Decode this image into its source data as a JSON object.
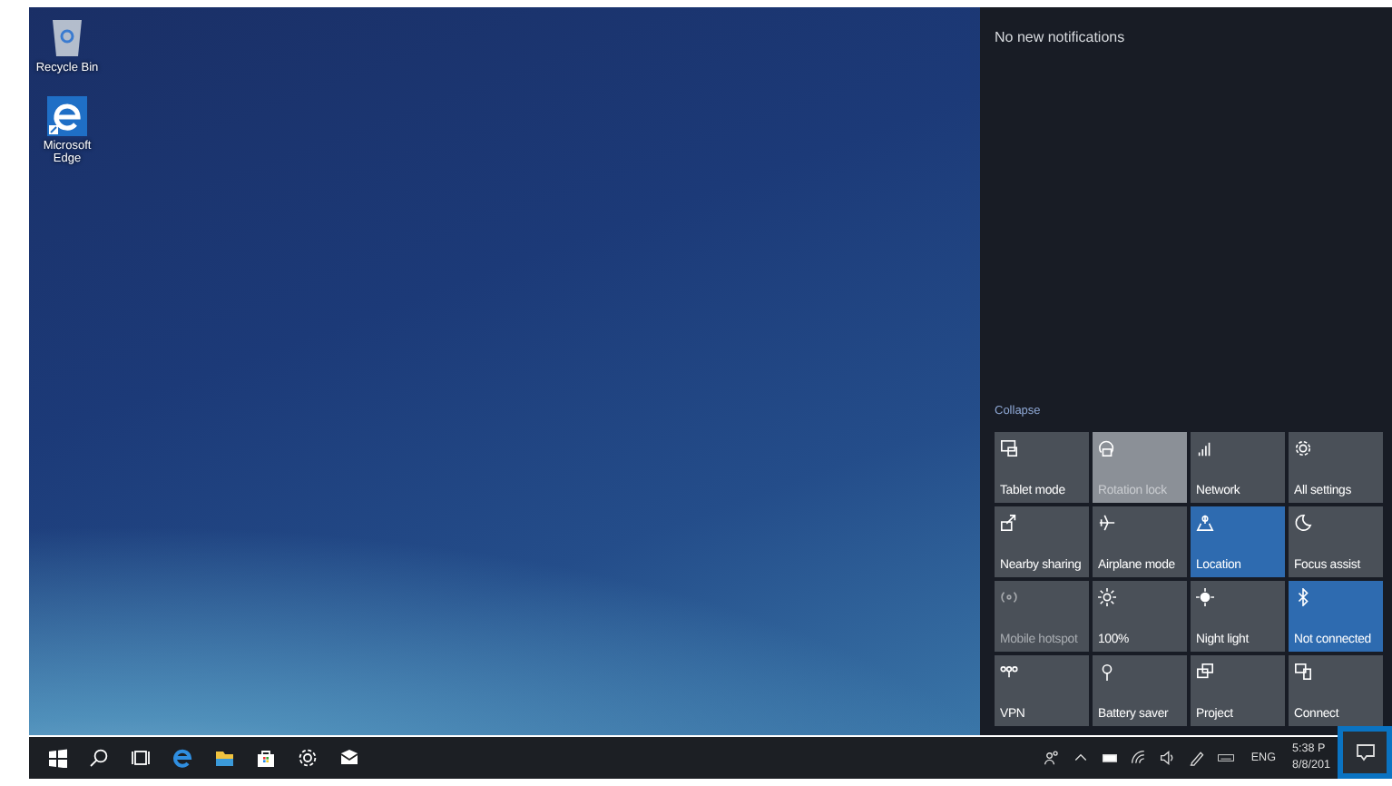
{
  "desktop": {
    "icons": [
      {
        "label": "Recycle Bin"
      },
      {
        "label": "Microsoft Edge"
      }
    ]
  },
  "action_center": {
    "message": "No new notifications",
    "collapse": "Collapse",
    "tiles": [
      {
        "label": "Tablet mode",
        "on": false,
        "disabled": false
      },
      {
        "label": "Rotation lock",
        "on": false,
        "disabled": true
      },
      {
        "label": "Network",
        "on": false,
        "disabled": false
      },
      {
        "label": "All settings",
        "on": false,
        "disabled": false
      },
      {
        "label": "Nearby sharing",
        "on": false,
        "disabled": false
      },
      {
        "label": "Airplane mode",
        "on": false,
        "disabled": false
      },
      {
        "label": "Location",
        "on": true,
        "disabled": false
      },
      {
        "label": "Focus assist",
        "on": false,
        "disabled": false
      },
      {
        "label": "Mobile hotspot",
        "on": false,
        "disabled": false,
        "dimmed": true
      },
      {
        "label": "100%",
        "on": false,
        "disabled": false
      },
      {
        "label": "Night light",
        "on": false,
        "disabled": false
      },
      {
        "label": "Not connected",
        "on": true,
        "disabled": false
      },
      {
        "label": "VPN",
        "on": false,
        "disabled": false
      },
      {
        "label": "Battery saver",
        "on": false,
        "disabled": false
      },
      {
        "label": "Project",
        "on": false,
        "disabled": false
      },
      {
        "label": "Connect",
        "on": false,
        "disabled": false
      }
    ]
  },
  "taskbar": {
    "language": "ENG",
    "time": "5:38 P",
    "date": "8/8/201"
  }
}
